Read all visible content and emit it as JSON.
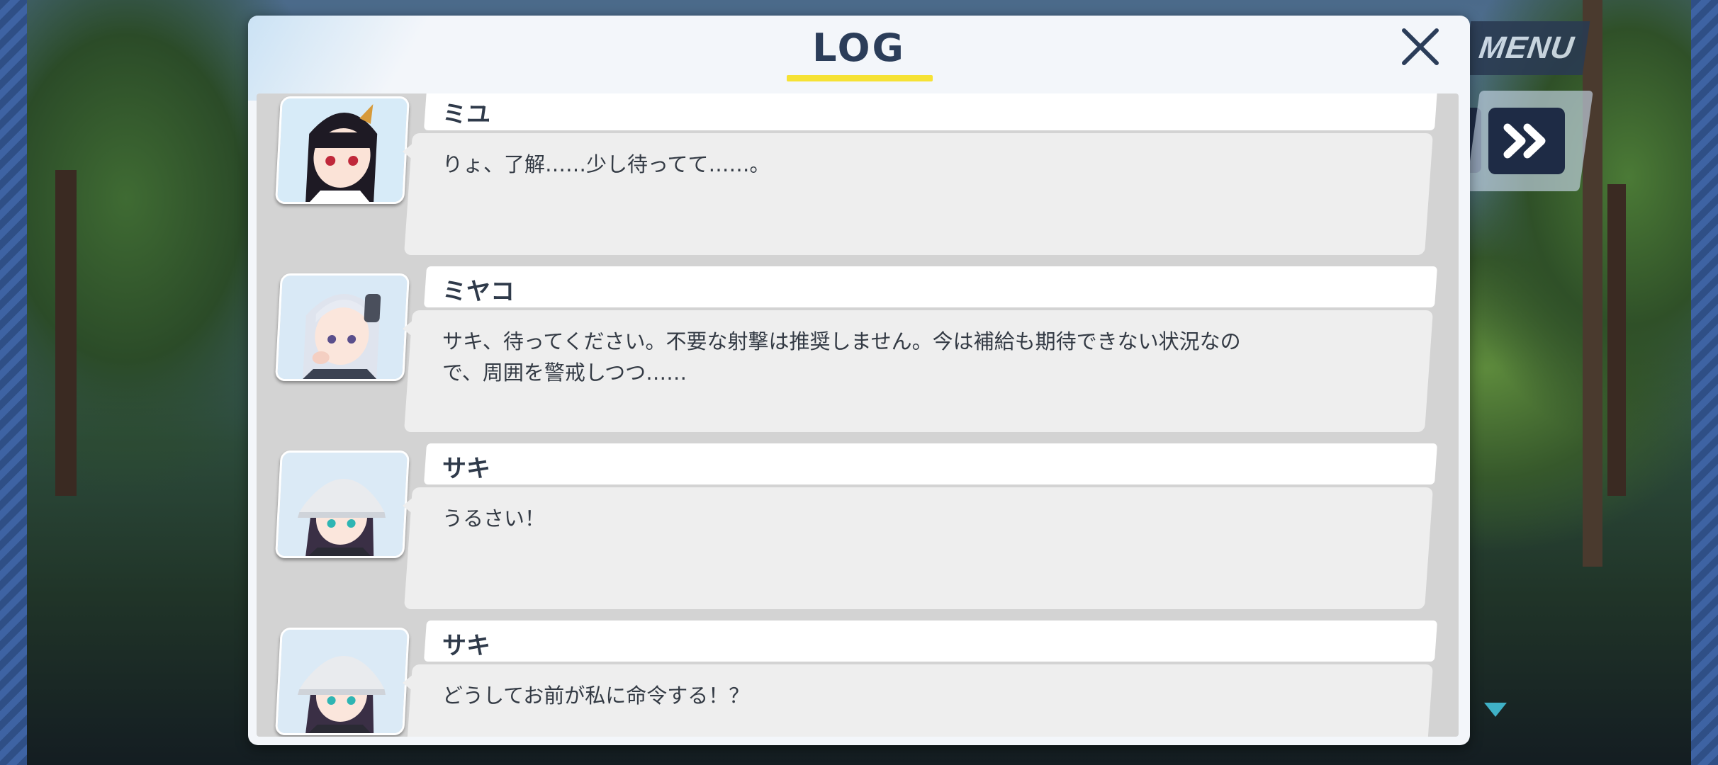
{
  "title": "LOG",
  "menu_label": "MENU",
  "colors": {
    "title_underline": "#f6e234",
    "panel": "#f3f6fa",
    "text_dark": "#2b3d59"
  },
  "entries": [
    {
      "speaker": "ミユ",
      "text": "りょ、了解……少し待ってて……。",
      "portrait": "miyu-portrait"
    },
    {
      "speaker": "ミヤコ",
      "text": "サキ、待ってください。不要な射撃は推奨しません。今は補給も期待できない状況なので、周囲を警戒しつつ……",
      "portrait": "miyako-portrait"
    },
    {
      "speaker": "サキ",
      "text": "うるさい！",
      "portrait": "saki-portrait"
    },
    {
      "speaker": "サキ",
      "text": "どうしてお前が私に命令する！？",
      "portrait": "saki-portrait"
    }
  ]
}
